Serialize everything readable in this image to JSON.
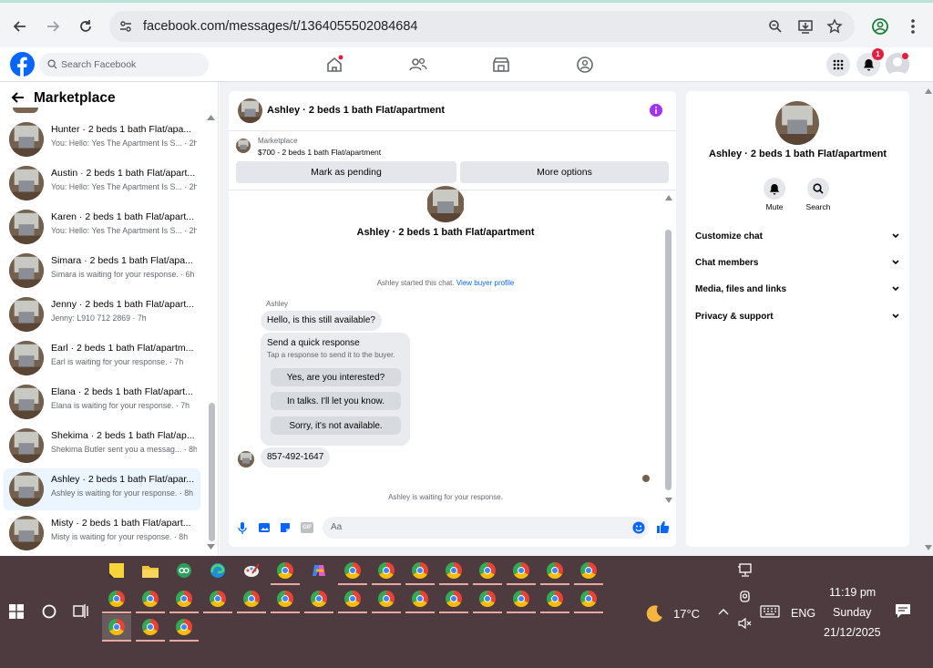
{
  "browser": {
    "url": "facebook.com/messages/t/1364055502084684"
  },
  "header": {
    "search_placeholder": "Search Facebook",
    "notification_count": "1"
  },
  "sidebar": {
    "title": "Marketplace",
    "conversations": [
      {
        "name": "Hunter · 2 beds 1 bath Flat/apa...",
        "preview": "You: Hello: Yes The Apartment Is S... · 2h"
      },
      {
        "name": "Austin · 2 beds 1 bath Flat/apart...",
        "preview": "You: Hello: Yes The Apartment Is S... · 2h"
      },
      {
        "name": "Karen · 2 beds 1 bath Flat/apart...",
        "preview": "You: Hello: Yes The Apartment Is S... · 2h"
      },
      {
        "name": "Simara · 2 beds 1 bath Flat/apa...",
        "preview": "Simara is waiting for your response. · 6h"
      },
      {
        "name": "Jenny · 2 beds 1 bath Flat/apart...",
        "preview": "Jenny: L910 712 2869 · 7h"
      },
      {
        "name": "Earl · 2 beds 1 bath Flat/apartm...",
        "preview": "Earl is waiting for your response. · 7h"
      },
      {
        "name": "Elana · 2 beds 1 bath Flat/apart...",
        "preview": "Elana is waiting for your response. · 7h"
      },
      {
        "name": "Shekima · 2 beds 1 bath Flat/ap...",
        "preview": "Shekima Butler sent you a messag... · 8h"
      },
      {
        "name": "Ashley · 2 beds 1 bath Flat/apar...",
        "preview": "Ashley is waiting for your response. · 8h"
      },
      {
        "name": "Misty · 2 beds 1 bath Flat/apart...",
        "preview": "Misty is waiting for your response. · 8h"
      }
    ]
  },
  "chat": {
    "title": "Ashley · 2 beds 1 bath Flat/apartment",
    "listing_label": "Marketplace",
    "listing_price_title": "$700 - 2 beds 1 bath Flat/apartment",
    "mark_pending": "Mark as pending",
    "more_options": "More options",
    "intro_name": "Ashley · 2 beds 1 bath Flat/apartment",
    "started_text": "Ashley started this chat.",
    "view_profile": "View buyer profile",
    "sender": "Ashley",
    "message1": "Hello, is this still available?",
    "quick_title": "Send a quick response",
    "quick_sub": "Tap a response to send it to the buyer.",
    "quick_responses": [
      "Yes, are you interested?",
      "In talks. I'll let you know.",
      "Sorry, it's not available."
    ],
    "message2": "857-492-1647",
    "waiting": "Ashley is waiting for your response.",
    "composer_placeholder": "Aa"
  },
  "details": {
    "name": "Ashley · 2 beds 1 bath Flat/apartment",
    "mute": "Mute",
    "search": "Search",
    "sections": [
      "Customize chat",
      "Chat members",
      "Media, files and links",
      "Privacy & support"
    ]
  },
  "taskbar": {
    "temperature": "17°C",
    "language": "ENG",
    "time": "11:19 pm",
    "day": "Sunday",
    "date": "21/12/2025"
  },
  "colors": {
    "accent": "#0866ff",
    "badge": "#e41e3f",
    "info": "#a033ff"
  }
}
